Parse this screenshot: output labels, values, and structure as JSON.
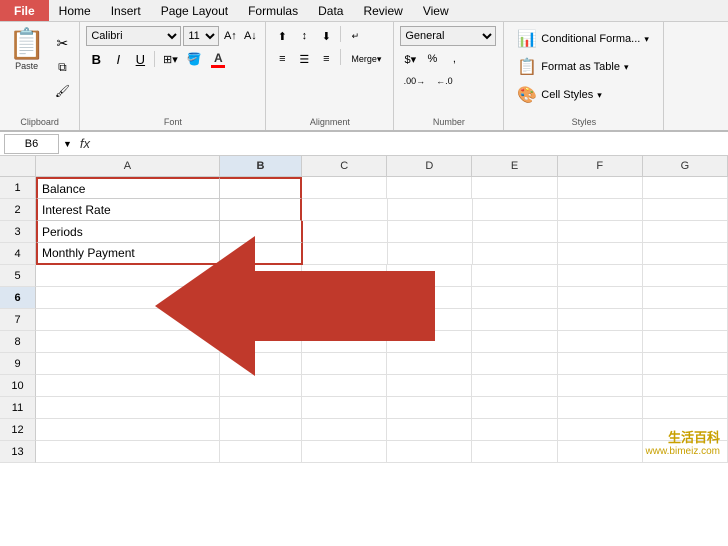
{
  "menubar": {
    "file": "File",
    "tabs": [
      "Home",
      "Insert",
      "Page Layout",
      "Formulas",
      "Data",
      "Review",
      "View"
    ]
  },
  "ribbon": {
    "clipboard": {
      "label": "Clipboard",
      "paste": "Paste",
      "cut": "✂",
      "copy": "⧉",
      "format_painter": "🖌"
    },
    "font": {
      "label": "Font",
      "name": "Calibri",
      "size": "11",
      "bold": "B",
      "italic": "I",
      "underline": "U",
      "font_color": "A",
      "highlight_color": "A"
    },
    "alignment": {
      "label": "Alignment"
    },
    "number": {
      "label": "Number",
      "format": "General"
    },
    "styles": {
      "label": "Styles",
      "conditional_format": "Conditional Forma...",
      "format_as_table": "Format as Table",
      "cell_styles": "Cell Styles"
    }
  },
  "formula_bar": {
    "cell_ref": "B6",
    "fx": "fx",
    "formula_value": ""
  },
  "spreadsheet": {
    "columns": [
      "A",
      "B",
      "C",
      "D",
      "E",
      "F",
      "G"
    ],
    "rows": [
      {
        "row": "1",
        "cells": [
          "Balance",
          "",
          "",
          "",
          "",
          "",
          ""
        ]
      },
      {
        "row": "2",
        "cells": [
          "Interest Rate",
          "",
          "",
          "",
          "",
          "",
          ""
        ]
      },
      {
        "row": "3",
        "cells": [
          "Periods",
          "",
          "",
          "",
          "",
          "",
          ""
        ]
      },
      {
        "row": "4",
        "cells": [
          "Monthly Payment",
          "",
          "",
          "",
          "",
          "",
          ""
        ]
      },
      {
        "row": "5",
        "cells": [
          "",
          "",
          "",
          "",
          "",
          "",
          ""
        ]
      },
      {
        "row": "6",
        "cells": [
          "",
          "",
          "",
          "",
          "",
          "",
          ""
        ]
      },
      {
        "row": "7",
        "cells": [
          "",
          "",
          "",
          "",
          "",
          "",
          ""
        ]
      },
      {
        "row": "8",
        "cells": [
          "",
          "",
          "",
          "",
          "",
          "",
          ""
        ]
      },
      {
        "row": "9",
        "cells": [
          "",
          "",
          "",
          "",
          "",
          "",
          ""
        ]
      },
      {
        "row": "10",
        "cells": [
          "",
          "",
          "",
          "",
          "",
          "",
          ""
        ]
      },
      {
        "row": "11",
        "cells": [
          "",
          "",
          "",
          "",
          "",
          "",
          ""
        ]
      },
      {
        "row": "12",
        "cells": [
          "",
          "",
          "",
          "",
          "",
          "",
          ""
        ]
      },
      {
        "row": "13",
        "cells": [
          "",
          "",
          "",
          "",
          "",
          "",
          ""
        ]
      }
    ]
  },
  "watermark": {
    "line1": "生活百科",
    "line2": "www.bimeiz.com"
  }
}
